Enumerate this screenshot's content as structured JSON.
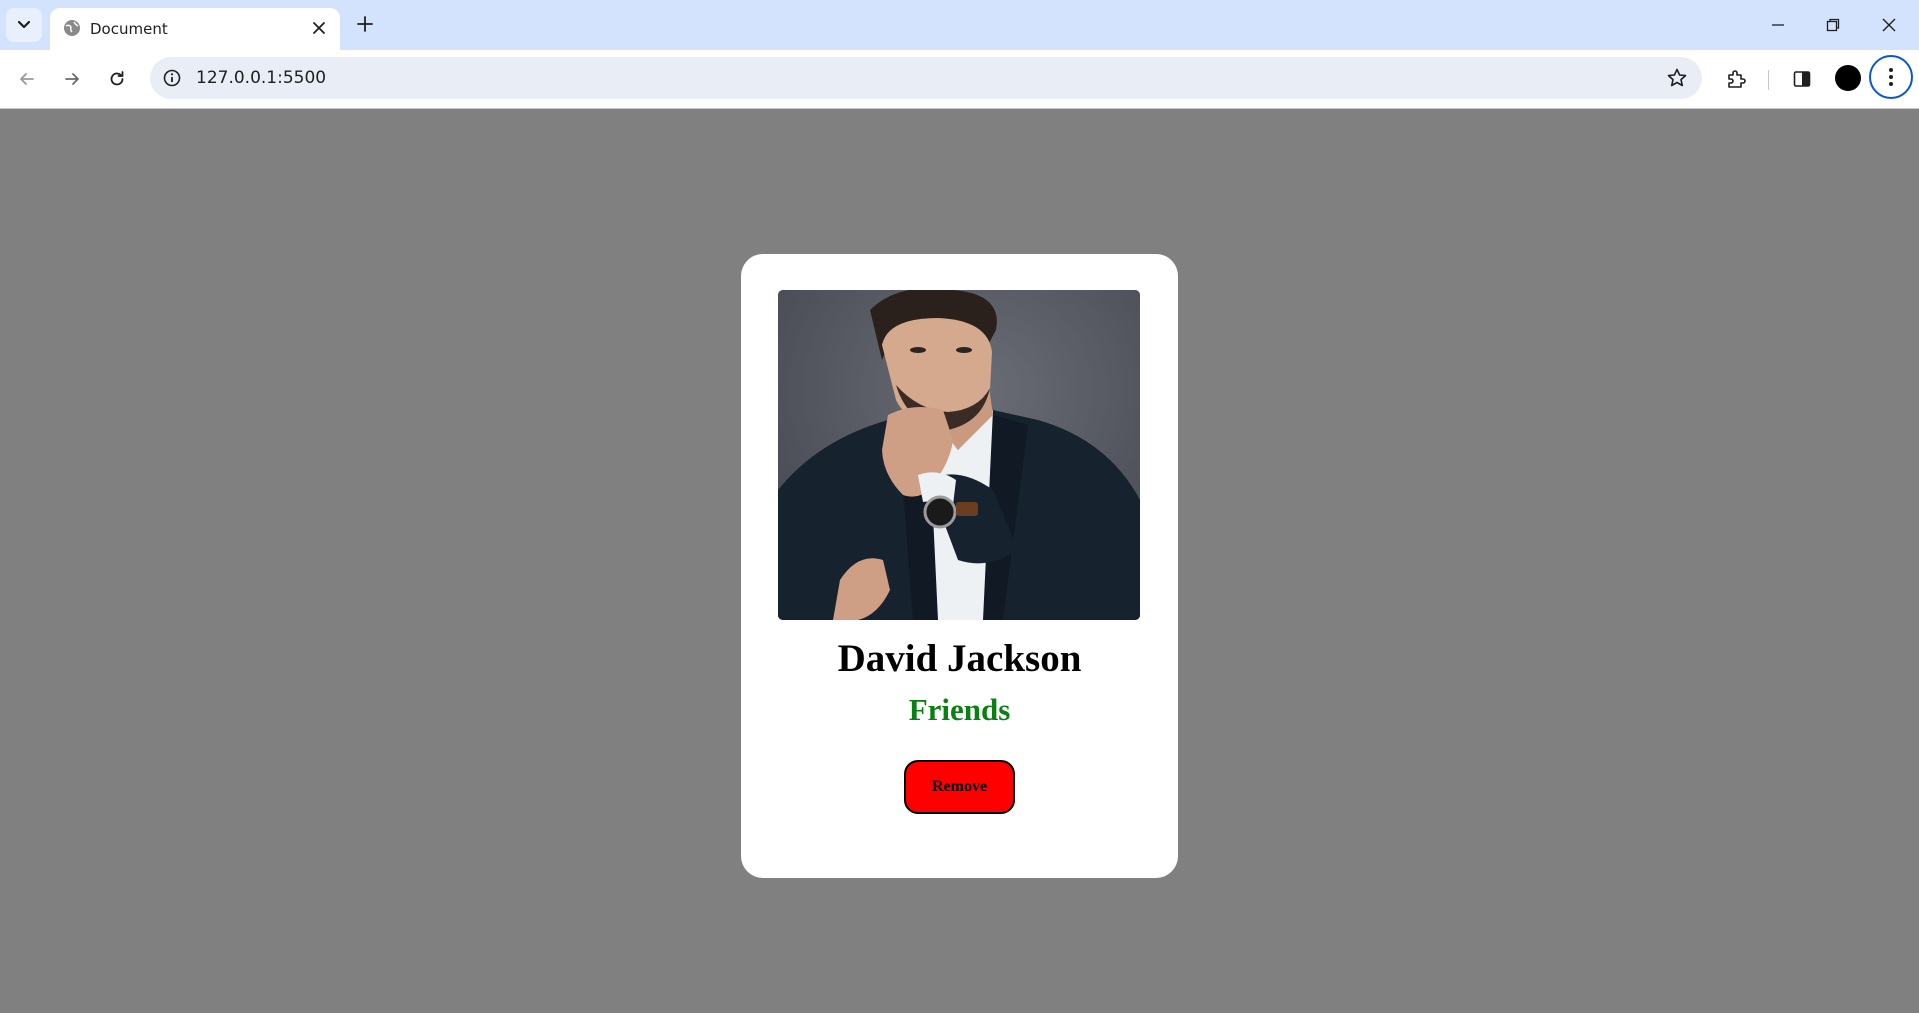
{
  "browser": {
    "tab_title": "Document",
    "url": "127.0.0.1:5500",
    "accent_color": "#0b57d0",
    "tabstrip_color": "#d3e3fd",
    "icons": {
      "tab_search": "chevron-down-icon",
      "favicon": "globe-icon",
      "tab_close": "close-icon",
      "new_tab": "plus-icon",
      "minimize": "minimize-icon",
      "restore": "restore-icon",
      "close_window": "close-icon",
      "back": "arrow-left-icon",
      "forward": "arrow-right-icon",
      "reload": "reload-icon",
      "site_info": "info-icon",
      "bookmark": "star-icon",
      "extensions": "puzzle-icon",
      "side_panel": "side-panel-icon",
      "profile": "avatar",
      "menu": "kebab-menu-icon"
    }
  },
  "page": {
    "background_color": "#808080",
    "card": {
      "photo_alt": "portrait-photo",
      "name": "David Jackson",
      "status": "Friends",
      "status_color": "#0a8012",
      "remove_label": "Remove",
      "remove_color": "#ff0000"
    }
  }
}
